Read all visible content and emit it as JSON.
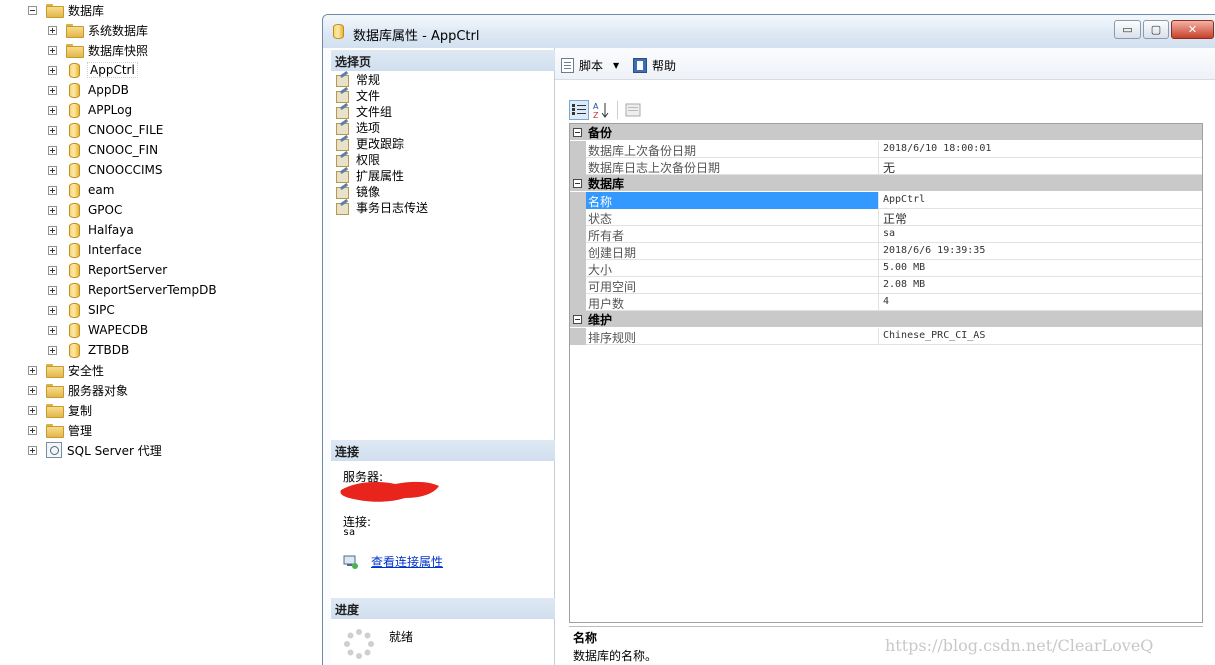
{
  "explorer": {
    "root_label": "数据库",
    "children": [
      {
        "label": "系统数据库",
        "type": "folder"
      },
      {
        "label": "数据库快照",
        "type": "folder"
      },
      {
        "label": "AppCtrl",
        "type": "db",
        "selected": true
      },
      {
        "label": "AppDB",
        "type": "db"
      },
      {
        "label": "APPLog",
        "type": "db"
      },
      {
        "label": "CNOOC_FILE",
        "type": "db"
      },
      {
        "label": "CNOOC_FIN",
        "type": "db"
      },
      {
        "label": "CNOOCCIMS",
        "type": "db"
      },
      {
        "label": "eam",
        "type": "db"
      },
      {
        "label": "GPOC",
        "type": "db"
      },
      {
        "label": "Halfaya",
        "type": "db"
      },
      {
        "label": "Interface",
        "type": "db"
      },
      {
        "label": "ReportServer",
        "type": "db"
      },
      {
        "label": "ReportServerTempDB",
        "type": "db"
      },
      {
        "label": "SIPC",
        "type": "db"
      },
      {
        "label": "WAPECDB",
        "type": "db"
      },
      {
        "label": "ZTBDB",
        "type": "db"
      }
    ],
    "top_items": [
      {
        "label": "安全性",
        "type": "folder"
      },
      {
        "label": "服务器对象",
        "type": "folder"
      },
      {
        "label": "复制",
        "type": "folder"
      },
      {
        "label": "管理",
        "type": "folder"
      },
      {
        "label": "SQL Server 代理",
        "type": "agent"
      }
    ]
  },
  "window": {
    "title": "数据库属性 - AppCtrl",
    "minimize": "▭",
    "maximize": "▢",
    "close": "✕"
  },
  "select_page": {
    "header": "选择页",
    "items": [
      "常规",
      "文件",
      "文件组",
      "选项",
      "更改跟踪",
      "权限",
      "扩展属性",
      "镜像",
      "事务日志传送"
    ]
  },
  "connection": {
    "header": "连接",
    "server_label": "服务器:",
    "connection_label": "连接:",
    "connection_value": "sa",
    "link": "查看连接属性"
  },
  "progress": {
    "header": "进度",
    "status": "就绪"
  },
  "toolbar": {
    "script_label": "脚本",
    "help_label": "帮助"
  },
  "properties": [
    {
      "category": "备份",
      "rows": [
        {
          "name": "数据库上次备份日期",
          "value": "2018/6/10 18:00:01"
        },
        {
          "name": "数据库日志上次备份日期",
          "value": "无"
        }
      ]
    },
    {
      "category": "数据库",
      "rows": [
        {
          "name": "名称",
          "value": "AppCtrl",
          "selected": true
        },
        {
          "name": "状态",
          "value": "正常"
        },
        {
          "name": "所有者",
          "value": "sa"
        },
        {
          "name": "创建日期",
          "value": "2018/6/6 19:39:35"
        },
        {
          "name": "大小",
          "value": "5.00 MB"
        },
        {
          "name": "可用空间",
          "value": "2.08 MB"
        },
        {
          "name": "用户数",
          "value": "4"
        }
      ]
    },
    {
      "category": "维护",
      "rows": [
        {
          "name": "排序规则",
          "value": "Chinese_PRC_CI_AS"
        }
      ]
    }
  ],
  "description": {
    "title": "名称",
    "text": "数据库的名称。"
  },
  "watermark": "https://blog.csdn.net/ClearLoveQ"
}
